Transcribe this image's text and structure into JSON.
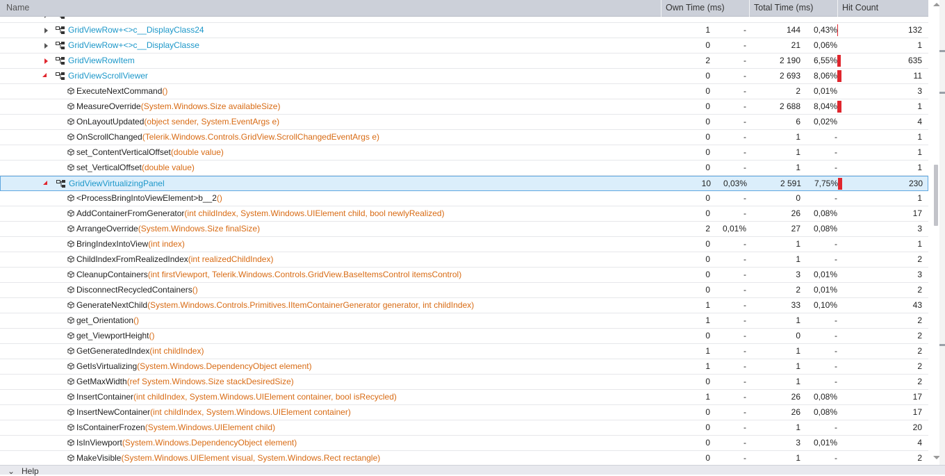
{
  "header": {
    "name": "Name",
    "own_time": "Own Time (ms)",
    "total_time": "Total Time (ms)",
    "hit_count": "Hit Count"
  },
  "colors": {
    "class_label": "#1c97c9",
    "params": "#d86b14",
    "hot_bar": "#e0262e",
    "selected_bg": "#dbeefb"
  },
  "rows": [
    {
      "kind": "class",
      "state": "partial",
      "level": 1,
      "name": "",
      "params": "",
      "own": "",
      "own_pct": "",
      "total": "",
      "total_pct": "",
      "hits": "",
      "bar_fraction": 0
    },
    {
      "kind": "class",
      "state": "collapsed",
      "level": 1,
      "name": "GridViewRow+<>c__DisplayClass24",
      "params": "",
      "own": "1",
      "own_pct": "-",
      "total": "144",
      "total_pct": "0,43%",
      "hits": "132",
      "bar_fraction": 0.04
    },
    {
      "kind": "class",
      "state": "collapsed",
      "level": 1,
      "name": "GridViewRow+<>c__DisplayClasse",
      "params": "",
      "own": "0",
      "own_pct": "-",
      "total": "21",
      "total_pct": "0,06%",
      "hits": "1",
      "bar_fraction": 0
    },
    {
      "kind": "class",
      "state": "collapsed-hot",
      "level": 1,
      "name": "GridViewRowItem",
      "params": "",
      "own": "2",
      "own_pct": "-",
      "total": "2 190",
      "total_pct": "6,55%",
      "hits": "635",
      "bar_fraction": 0.65
    },
    {
      "kind": "class",
      "state": "expanded",
      "level": 1,
      "name": "GridViewScrollViewer",
      "params": "",
      "own": "0",
      "own_pct": "-",
      "total": "2 693",
      "total_pct": "8,06%",
      "hits": "11",
      "bar_fraction": 0.8
    },
    {
      "kind": "method",
      "level": 2,
      "name": "ExecuteNextCommand",
      "params": "()",
      "own": "0",
      "own_pct": "-",
      "total": "2",
      "total_pct": "0,01%",
      "hits": "3",
      "bar_fraction": 0
    },
    {
      "kind": "method",
      "level": 2,
      "name": "MeasureOverride",
      "params": "(System.Windows.Size availableSize)",
      "own": "0",
      "own_pct": "-",
      "total": "2 688",
      "total_pct": "8,04%",
      "hits": "1",
      "bar_fraction": 0.8
    },
    {
      "kind": "method",
      "level": 2,
      "name": "OnLayoutUpdated",
      "params": "(object sender, System.EventArgs e)",
      "own": "0",
      "own_pct": "-",
      "total": "6",
      "total_pct": "0,02%",
      "hits": "4",
      "bar_fraction": 0
    },
    {
      "kind": "method",
      "level": 2,
      "name": "OnScrollChanged",
      "params": "(Telerik.Windows.Controls.GridView.ScrollChangedEventArgs e)",
      "own": "0",
      "own_pct": "-",
      "total": "1",
      "total_pct": "-",
      "hits": "1",
      "bar_fraction": 0
    },
    {
      "kind": "method",
      "level": 2,
      "name": "set_ContentVerticalOffset",
      "params": "(double value)",
      "own": "0",
      "own_pct": "-",
      "total": "1",
      "total_pct": "-",
      "hits": "1",
      "bar_fraction": 0
    },
    {
      "kind": "method",
      "level": 2,
      "name": "set_VerticalOffset",
      "params": "(double value)",
      "own": "0",
      "own_pct": "-",
      "total": "1",
      "total_pct": "-",
      "hits": "1",
      "bar_fraction": 0
    },
    {
      "kind": "class",
      "state": "expanded",
      "level": 1,
      "selected": true,
      "name": "GridViewVirtualizingPanel",
      "params": "",
      "own": "10",
      "own_pct": "0,03%",
      "total": "2 591",
      "total_pct": "7,75%",
      "hits": "230",
      "bar_fraction": 0.75
    },
    {
      "kind": "method",
      "level": 2,
      "name": "<ProcessBringIntoViewElement>b__2",
      "params": "()",
      "own": "0",
      "own_pct": "-",
      "total": "0",
      "total_pct": "-",
      "hits": "1",
      "bar_fraction": 0
    },
    {
      "kind": "method",
      "level": 2,
      "name": "AddContainerFromGenerator",
      "params": "(int childIndex, System.Windows.UIElement child, bool newlyRealized)",
      "own": "0",
      "own_pct": "-",
      "total": "26",
      "total_pct": "0,08%",
      "hits": "17",
      "bar_fraction": 0
    },
    {
      "kind": "method",
      "level": 2,
      "name": "ArrangeOverride",
      "params": "(System.Windows.Size finalSize)",
      "own": "2",
      "own_pct": "0,01%",
      "total": "27",
      "total_pct": "0,08%",
      "hits": "3",
      "bar_fraction": 0
    },
    {
      "kind": "method",
      "level": 2,
      "name": "BringIndexIntoView",
      "params": "(int index)",
      "own": "0",
      "own_pct": "-",
      "total": "1",
      "total_pct": "-",
      "hits": "1",
      "bar_fraction": 0
    },
    {
      "kind": "method",
      "level": 2,
      "name": "ChildIndexFromRealizedIndex",
      "params": "(int realizedChildIndex)",
      "own": "0",
      "own_pct": "-",
      "total": "1",
      "total_pct": "-",
      "hits": "2",
      "bar_fraction": 0
    },
    {
      "kind": "method",
      "level": 2,
      "name": "CleanupContainers",
      "params": "(int firstViewport, Telerik.Windows.Controls.GridView.BaseItemsControl itemsControl)",
      "own": "0",
      "own_pct": "-",
      "total": "3",
      "total_pct": "0,01%",
      "hits": "3",
      "bar_fraction": 0
    },
    {
      "kind": "method",
      "level": 2,
      "name": "DisconnectRecycledContainers",
      "params": "()",
      "own": "0",
      "own_pct": "-",
      "total": "2",
      "total_pct": "0,01%",
      "hits": "2",
      "bar_fraction": 0
    },
    {
      "kind": "method",
      "level": 2,
      "name": "GenerateNextChild",
      "params": "(System.Windows.Controls.Primitives.IItemContainerGenerator generator, int childIndex)",
      "own": "1",
      "own_pct": "-",
      "total": "33",
      "total_pct": "0,10%",
      "hits": "43",
      "bar_fraction": 0
    },
    {
      "kind": "method",
      "level": 2,
      "name": "get_Orientation",
      "params": "()",
      "own": "1",
      "own_pct": "-",
      "total": "1",
      "total_pct": "-",
      "hits": "2",
      "bar_fraction": 0
    },
    {
      "kind": "method",
      "level": 2,
      "name": "get_ViewportHeight",
      "params": "()",
      "own": "0",
      "own_pct": "-",
      "total": "0",
      "total_pct": "-",
      "hits": "2",
      "bar_fraction": 0
    },
    {
      "kind": "method",
      "level": 2,
      "name": "GetGeneratedIndex",
      "params": "(int childIndex)",
      "own": "1",
      "own_pct": "-",
      "total": "1",
      "total_pct": "-",
      "hits": "2",
      "bar_fraction": 0
    },
    {
      "kind": "method",
      "level": 2,
      "name": "GetIsVirtualizing",
      "params": "(System.Windows.DependencyObject element)",
      "own": "1",
      "own_pct": "-",
      "total": "1",
      "total_pct": "-",
      "hits": "2",
      "bar_fraction": 0
    },
    {
      "kind": "method",
      "level": 2,
      "name": "GetMaxWidth",
      "params": "(ref System.Windows.Size stackDesiredSize)",
      "own": "0",
      "own_pct": "-",
      "total": "1",
      "total_pct": "-",
      "hits": "2",
      "bar_fraction": 0
    },
    {
      "kind": "method",
      "level": 2,
      "name": "InsertContainer",
      "params": "(int childIndex, System.Windows.UIElement container, bool isRecycled)",
      "own": "1",
      "own_pct": "-",
      "total": "26",
      "total_pct": "0,08%",
      "hits": "17",
      "bar_fraction": 0
    },
    {
      "kind": "method",
      "level": 2,
      "name": "InsertNewContainer",
      "params": "(int childIndex, System.Windows.UIElement container)",
      "own": "0",
      "own_pct": "-",
      "total": "26",
      "total_pct": "0,08%",
      "hits": "17",
      "bar_fraction": 0
    },
    {
      "kind": "method",
      "level": 2,
      "name": "IsContainerFrozen",
      "params": "(System.Windows.UIElement child)",
      "own": "0",
      "own_pct": "-",
      "total": "1",
      "total_pct": "-",
      "hits": "20",
      "bar_fraction": 0
    },
    {
      "kind": "method",
      "level": 2,
      "name": "IsInViewport",
      "params": "(System.Windows.DependencyObject element)",
      "own": "0",
      "own_pct": "-",
      "total": "3",
      "total_pct": "0,01%",
      "hits": "4",
      "bar_fraction": 0
    },
    {
      "kind": "method",
      "level": 2,
      "name": "MakeVisible",
      "params": "(System.Windows.UIElement visual, System.Windows.Rect rectangle)",
      "own": "0",
      "own_pct": "-",
      "total": "1",
      "total_pct": "-",
      "hits": "2",
      "bar_fraction": 0
    }
  ],
  "footer": {
    "help_label": "Help"
  }
}
